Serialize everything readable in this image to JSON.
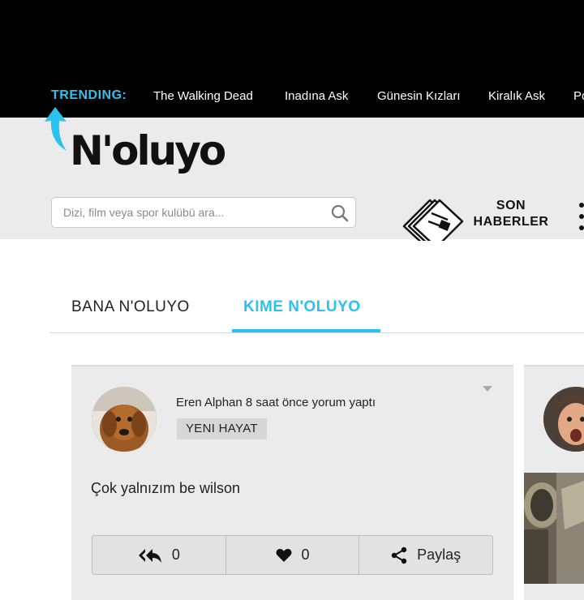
{
  "topbar": {
    "trending_label": "TRENDING:",
    "links": [
      "The Walking Dead",
      "Inadına Ask",
      "Günesin Kızları",
      "Kiralık Ask",
      "Po"
    ]
  },
  "header": {
    "logo": "N'oluyo",
    "search": {
      "placeholder": "Dizi, film veya spor kulübü ara...",
      "value": ""
    },
    "news_line1": "SON",
    "news_line2": "HABERLER"
  },
  "tabs": [
    {
      "label": "BANA N'OLUYO",
      "active": false
    },
    {
      "label": "KIME N'OLUYO",
      "active": true
    }
  ],
  "post": {
    "author_line": "Eren Alphan 8 saat önce yorum yaptı",
    "tag": "YENI HAYAT",
    "comment": "Çok yalnızım be wilson",
    "reply_count": "0",
    "like_count": "0",
    "share_label": "Paylaş"
  },
  "colors": {
    "accent": "#2bc2f0",
    "topbar": "#000000",
    "header_bg": "#ebebeb",
    "card_bg": "#ebebeb"
  },
  "icons": [
    "arrow-icon",
    "search-icon",
    "newspaper-icon",
    "more-icon",
    "caret-down-icon",
    "reply-all-icon",
    "heart-icon",
    "share-icon"
  ]
}
